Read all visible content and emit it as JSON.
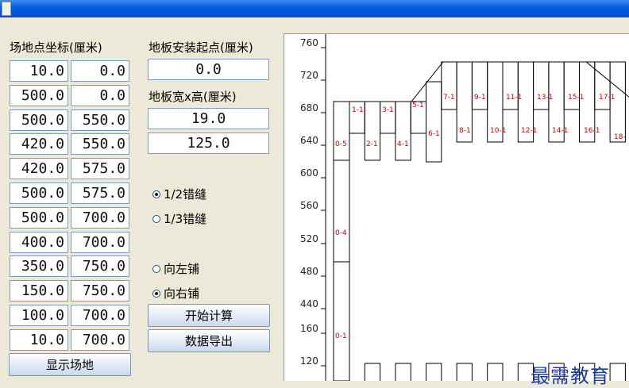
{
  "labels": {
    "coords_title": "场地点坐标(厘米)",
    "start_title": "地板安装起点(厘米)",
    "size_title": "地板宽x高(厘米)"
  },
  "coords": [
    [
      "10.0",
      "0.0"
    ],
    [
      "500.0",
      "0.0"
    ],
    [
      "500.0",
      "550.0"
    ],
    [
      "420.0",
      "550.0"
    ],
    [
      "420.0",
      "575.0"
    ],
    [
      "500.0",
      "575.0"
    ],
    [
      "500.0",
      "700.0"
    ],
    [
      "400.0",
      "700.0"
    ],
    [
      "350.0",
      "750.0"
    ],
    [
      "150.0",
      "750.0"
    ],
    [
      "100.0",
      "700.0"
    ],
    [
      "10.0",
      "700.0"
    ]
  ],
  "start_point": "0.0",
  "board_width": "19.0",
  "board_height": "125.0",
  "radios": {
    "half_offset": "1/2错缝",
    "third_offset": "1/3错缝",
    "lay_left": "向左铺",
    "lay_right": "向右铺",
    "selected_offset": "1/2错缝",
    "selected_direction": "向右铺"
  },
  "buttons": {
    "compute": "开始计算",
    "export": "数据导出",
    "show_site": "显示场地"
  },
  "plot": {
    "y_ticks": [
      "760",
      "720",
      "680",
      "640",
      "600",
      "560",
      "520",
      "480",
      "440",
      "160",
      "120"
    ],
    "board_labels": [
      "1-1",
      "2-1",
      "3-1",
      "4-1",
      "5-1",
      "6-1",
      "7-1",
      "8-1",
      "9-1",
      "10-1",
      "11-1",
      "12-1",
      "13-1",
      "14-1",
      "15-1",
      "16-1",
      "17-1",
      "18-"
    ],
    "first_column_labels": [
      "0-5",
      "0-4",
      "0-1"
    ],
    "label_color": "#cc0000"
  },
  "watermark": "最需教育"
}
